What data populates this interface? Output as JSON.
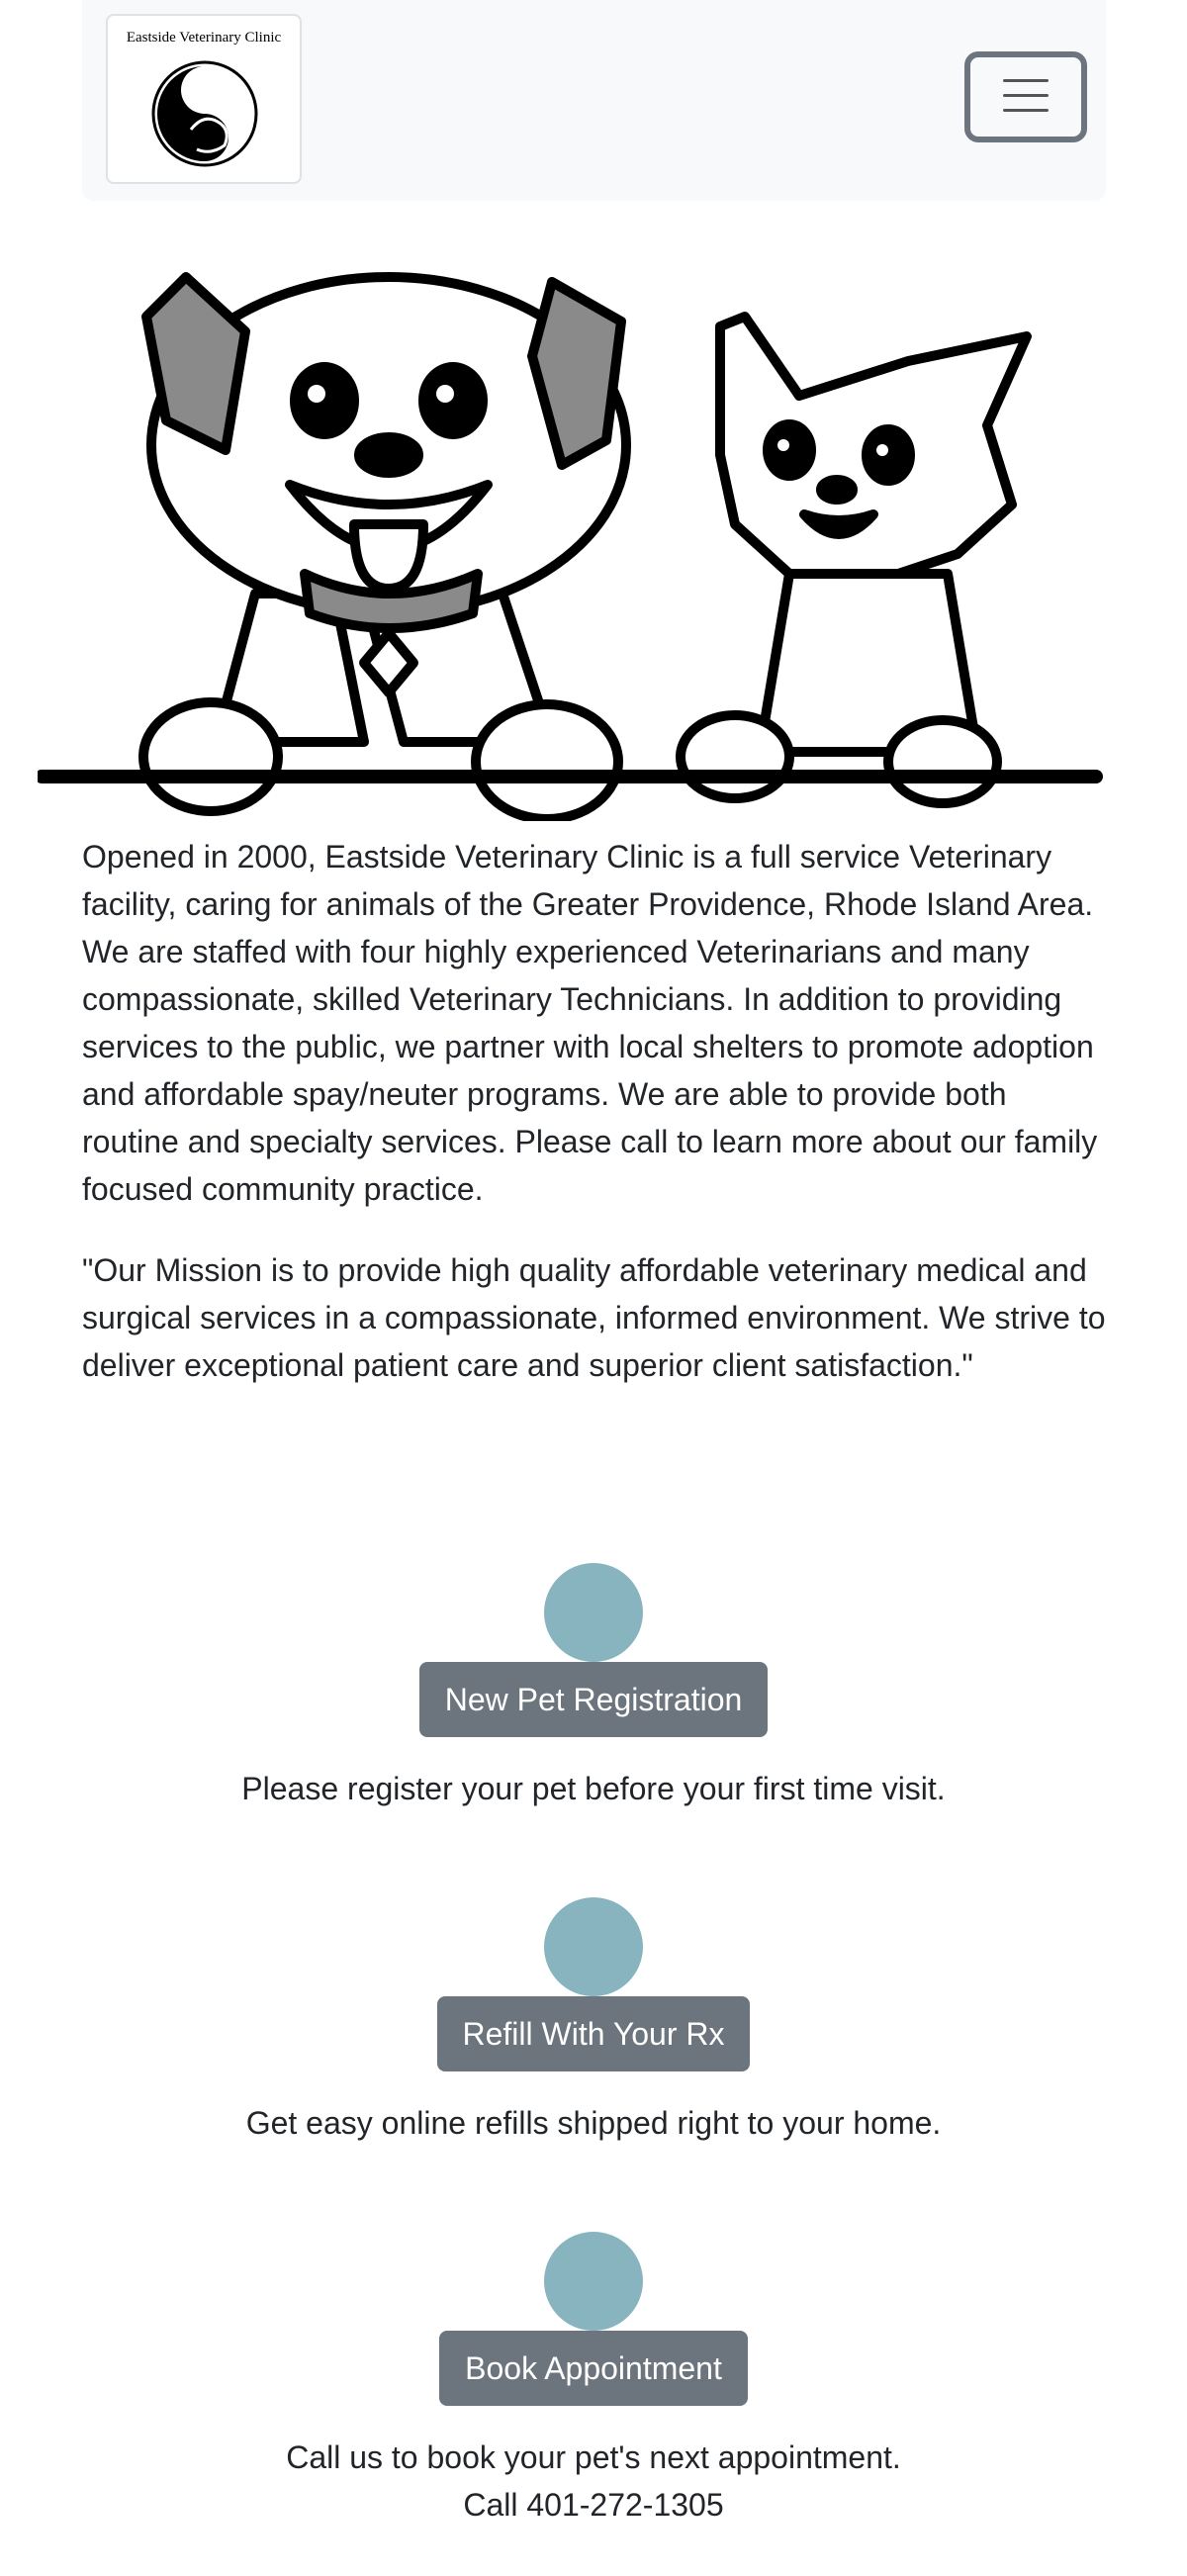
{
  "header": {
    "logo_text": "Eastside Veterinary Clinic",
    "menu_icon": "hamburger-menu-icon"
  },
  "intro": {
    "paragraph": "Opened in 2000, Eastside Veterinary Clinic is a full service Veterinary facility, caring for animals of the Greater Providence, Rhode Island Area. We are staffed with four highly experienced Veterinarians and many compassionate, skilled Veterinary Technicians. In addition to providing services to the public, we partner with local shelters to promote adoption and affordable spay/neuter programs. We are able to provide both routine and specialty services. Please call to learn more about our family focused community practice.",
    "mission": "\"Our Mission is to provide high quality affordable veterinary medical and surgical services in a compassionate, informed environment. We strive to deliver exceptional patient care and superior client satisfaction.\""
  },
  "ctas": [
    {
      "button": "New Pet Registration",
      "description": "Please register your pet before your first time visit."
    },
    {
      "button": "Refill With Your Rx",
      "description": "Get easy online refills shipped right to your home."
    },
    {
      "button": "Book Appointment",
      "description": "Call us to book your pet's next appointment.",
      "phone": "Call 401-272-1305"
    }
  ],
  "colors": {
    "navbar_bg": "#f8f9fa",
    "button_bg": "#6c757d",
    "circle_accent": "#87b4be",
    "text": "#212529"
  }
}
